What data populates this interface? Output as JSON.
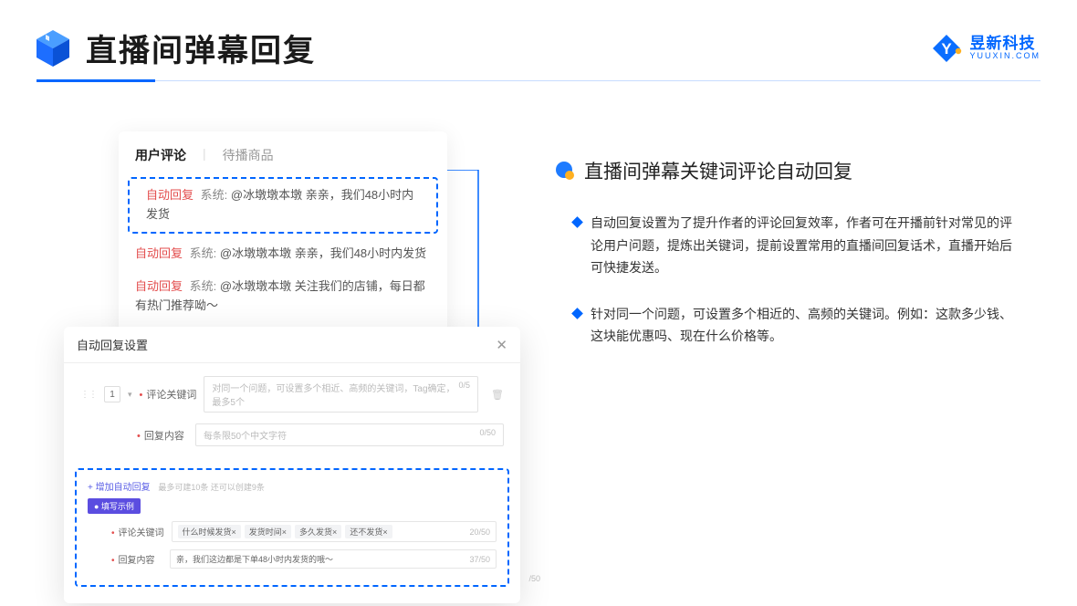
{
  "header": {
    "title": "直播间弹幕回复",
    "brand_cn": "昱新科技",
    "brand_en": "YUUXIN.COM"
  },
  "mock": {
    "tab_active": "用户评论",
    "tab_inactive": "待播商品",
    "comments": [
      {
        "auto": "自动回复",
        "sys": "系统:",
        "text": "@冰墩墩本墩 亲亲，我们48小时内发货"
      },
      {
        "auto": "自动回复",
        "sys": "系统:",
        "text": "@冰墩墩本墩 亲亲，我们48小时内发货"
      },
      {
        "auto": "自动回复",
        "sys": "系统:",
        "text": "@冰墩墩本墩 关注我们的店铺，每日都有热门推荐呦～"
      }
    ]
  },
  "settings": {
    "title": "自动回复设置",
    "index": "1",
    "label_keyword": "评论关键词",
    "placeholder_keyword": "对同一个问题，可设置多个相近、高频的关键词，Tag确定，最多5个",
    "counter_keyword": "0/5",
    "label_content": "回复内容",
    "placeholder_content": "每条限50个中文字符",
    "counter_content": "0/50",
    "add_link": "+ 增加自动回复",
    "add_note": "最多可建10条 还可以创建9条",
    "example_tag": "● 填写示例",
    "example_label_keyword": "评论关键词",
    "chips": [
      "什么时候发货×",
      "发货时间×",
      "多久发货×",
      "还不发货×"
    ],
    "chip_counter": "20/50",
    "example_label_content": "回复内容",
    "example_content": "亲，我们这边都是下单48小时内发货的哦～",
    "example_counter": "37/50",
    "hanging_counter": "/50"
  },
  "right": {
    "heading": "直播间弹幕关键词评论自动回复",
    "bullets": [
      "自动回复设置为了提升作者的评论回复效率，作者可在开播前针对常见的评论用户问题，提炼出关键词，提前设置常用的直播间回复话术，直播开始后可快捷发送。",
      "针对同一个问题，可设置多个相近的、高频的关键词。例如：这款多少钱、这块能优惠吗、现在什么价格等。"
    ]
  }
}
